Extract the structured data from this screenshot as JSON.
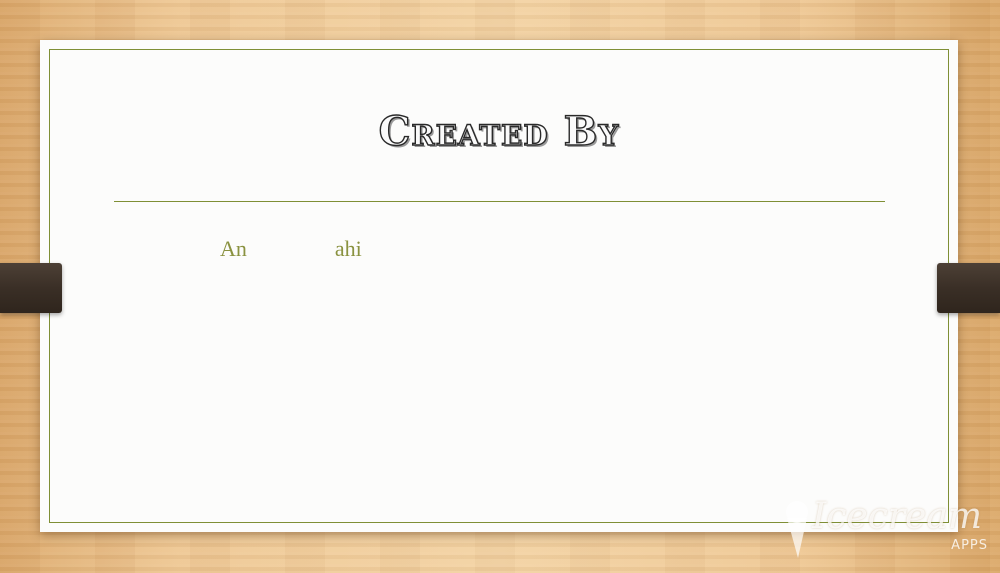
{
  "slide": {
    "title": "Created By",
    "author": {
      "start": "An",
      "hidden": "                ",
      "end": "ahi"
    }
  },
  "watermark": {
    "brand": "Icecream",
    "sub": "APPS",
    "icon": "ice-cream-cone-icon"
  },
  "colors": {
    "accent": "#7f8f35",
    "author_text": "#8a9240",
    "strap": "#3a2f26",
    "wood": "#eec794"
  }
}
